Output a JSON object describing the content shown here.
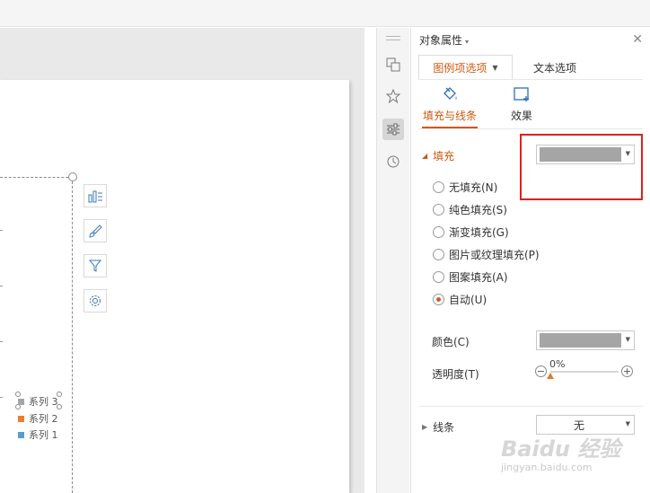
{
  "panel": {
    "title": "对象属性",
    "tabs": [
      {
        "label": "图例项选项"
      },
      {
        "label": "文本选项"
      }
    ],
    "subtabs": [
      {
        "label": "填充与线条",
        "icon": "paint-bucket-icon"
      },
      {
        "label": "效果",
        "icon": "effects-icon"
      }
    ],
    "fill": {
      "heading": "填充",
      "options": [
        {
          "label": "无填充(N)",
          "checked": false
        },
        {
          "label": "纯色填充(S)",
          "checked": false
        },
        {
          "label": "渐变填充(G)",
          "checked": false
        },
        {
          "label": "图片或纹理填充(P)",
          "checked": false
        },
        {
          "label": "图案填充(A)",
          "checked": false
        },
        {
          "label": "自动(U)",
          "checked": true
        }
      ],
      "color_label": "颜色(C)",
      "transparency_label": "透明度(T)",
      "transparency_value": "0%",
      "swatch_color": "#a5a5a5"
    },
    "line": {
      "heading": "线条",
      "value": "无"
    }
  },
  "legend": {
    "items": [
      {
        "label": "系列 3",
        "color": "#a5a5a5"
      },
      {
        "label": "系列 2",
        "color": "#ed7d31"
      },
      {
        "label": "系列 1",
        "color": "#5b9bd5"
      }
    ]
  },
  "watermark": {
    "brand": "Baidu 经验",
    "url": "jingyan.baidu.com"
  },
  "colors": {
    "accent": "#d0590e",
    "highlight_box": "#e0201a"
  }
}
